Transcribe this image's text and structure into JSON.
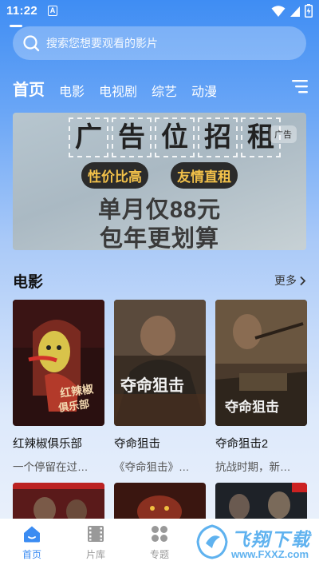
{
  "status_bar": {
    "time": "11:22",
    "notif_letter": "A"
  },
  "search": {
    "placeholder": "搜索您想要观看的影片"
  },
  "tabs": [
    {
      "label": "首页",
      "active": true
    },
    {
      "label": "电影",
      "active": false
    },
    {
      "label": "电视剧",
      "active": false
    },
    {
      "label": "综艺",
      "active": false
    },
    {
      "label": "动漫",
      "active": false
    }
  ],
  "banner": {
    "title_chars": [
      "广",
      "告",
      "位",
      "招",
      "租"
    ],
    "badge": "广告",
    "tag1": "性价比高",
    "tag2": "友情直租",
    "line1": "单月仅88元",
    "line2": "包年更划算"
  },
  "section": {
    "title": "电影",
    "more": "更多"
  },
  "movies": [
    {
      "title": "红辣椒俱乐部",
      "desc": "一个停留在过…"
    },
    {
      "title": "夺命狙击",
      "desc": "《夺命狙击》…"
    },
    {
      "title": "夺命狙击2",
      "desc": "抗战时期，新…"
    }
  ],
  "nav": [
    {
      "label": "首页",
      "icon": "home-icon",
      "active": true
    },
    {
      "label": "片库",
      "icon": "film-icon",
      "active": false
    },
    {
      "label": "专题",
      "icon": "grid-icon",
      "active": false
    },
    {
      "label": "",
      "icon": "",
      "active": false
    },
    {
      "label": "",
      "icon": "",
      "active": false
    }
  ],
  "watermark": {
    "title": "飞翔下载",
    "url": "www.FXXZ.com"
  },
  "colors": {
    "accent": "#3b8cf2",
    "header_blue": "#3f8df3",
    "tag_yellow": "#f2c14a"
  }
}
